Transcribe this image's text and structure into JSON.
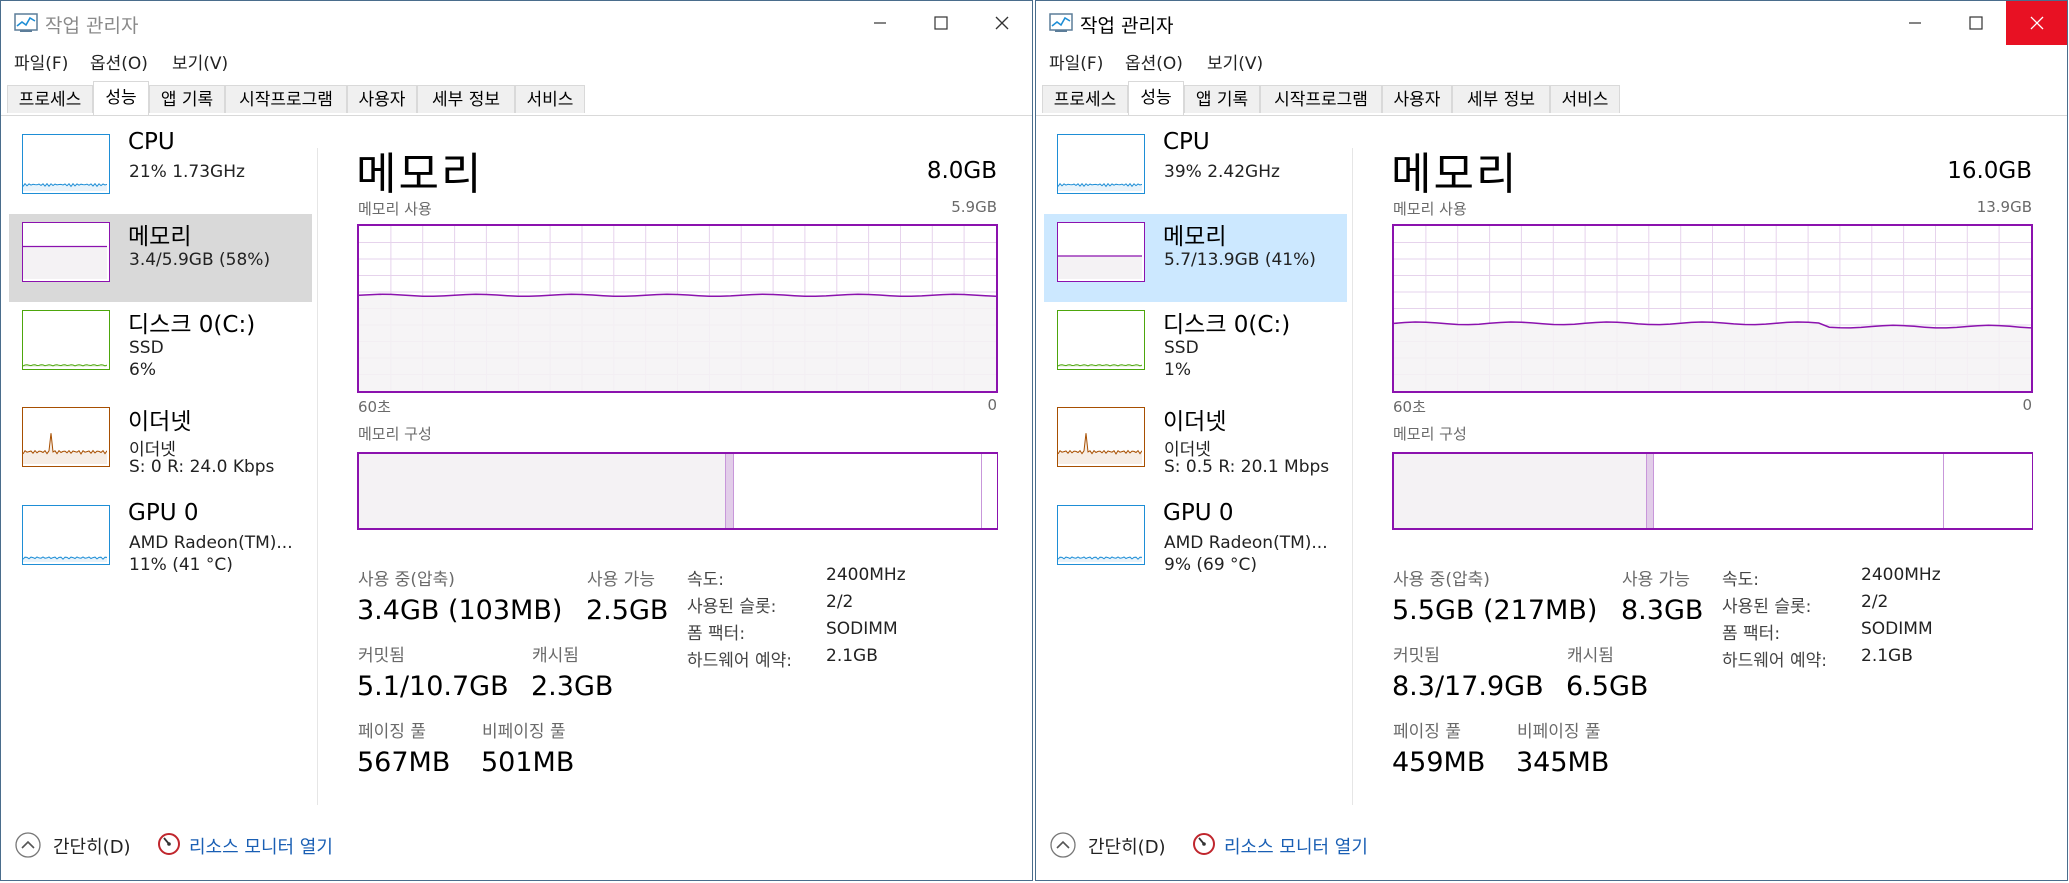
{
  "windows": [
    {
      "title": "작업 관리자",
      "active": false,
      "menu": [
        "파일(F)",
        "옵션(O)",
        "보기(V)"
      ],
      "tabs": [
        "프로세스",
        "성능",
        "앱 기록",
        "시작프로그램",
        "사용자",
        "세부 정보",
        "서비스"
      ],
      "selected_tab": 1,
      "sidebar": [
        {
          "title": "CPU",
          "lines": [
            "21% 1.73GHz"
          ],
          "color": "#1e8ed6",
          "kind": "cpu"
        },
        {
          "title": "메모리",
          "lines": [
            "3.4/5.9GB (58%)"
          ],
          "color": "#8b12ae",
          "kind": "mem",
          "level": 0.58
        },
        {
          "title": "디스크 0(C:)",
          "lines": [
            "SSD",
            "6%"
          ],
          "color": "#4da60c",
          "kind": "disk"
        },
        {
          "title": "이더넷",
          "lines": [
            "이더넷",
            "S: 0 R: 24.0 Kbps"
          ],
          "color": "#a74f01",
          "kind": "eth"
        },
        {
          "title": "GPU 0",
          "lines": [
            "AMD Radeon(TM)...",
            "11% (41 °C)"
          ],
          "color": "#1e8ed6",
          "kind": "gpu"
        }
      ],
      "memory": {
        "title": "메모리",
        "total": "8.0GB",
        "usage_label": "메모리 사용",
        "usage_max": "5.9GB",
        "axis_left": "60초",
        "axis_right": "0",
        "usage_level": 0.58,
        "composition_label": "메모리 구성",
        "composition": {
          "in_use": 0.575,
          "modified": 0.012,
          "standby": 0.39,
          "free": 0.023
        },
        "stats": [
          {
            "label": "사용 중(압축)",
            "value": "3.4GB (103MB)"
          },
          {
            "label": "사용 가능",
            "value": "2.5GB"
          },
          {
            "label": "커밋됨",
            "value": "5.1/10.7GB"
          },
          {
            "label": "캐시됨",
            "value": "2.3GB"
          },
          {
            "label": "페이징 풀",
            "value": "567MB"
          },
          {
            "label": "비페이징 풀",
            "value": "501MB"
          }
        ],
        "details": [
          {
            "label": "속도:",
            "value": "2400MHz"
          },
          {
            "label": "사용된 슬롯:",
            "value": "2/2"
          },
          {
            "label": "폼 팩터:",
            "value": "SODIMM"
          },
          {
            "label": "하드웨어 예약:",
            "value": "2.1GB"
          }
        ]
      },
      "footer": {
        "fewer": "간단히(D)",
        "resource_monitor": "리소스 모니터 열기"
      }
    },
    {
      "title": "작업 관리자",
      "active": true,
      "menu": [
        "파일(F)",
        "옵션(O)",
        "보기(V)"
      ],
      "tabs": [
        "프로세스",
        "성능",
        "앱 기록",
        "시작프로그램",
        "사용자",
        "세부 정보",
        "서비스"
      ],
      "selected_tab": 1,
      "sidebar": [
        {
          "title": "CPU",
          "lines": [
            "39% 2.42GHz"
          ],
          "color": "#1e8ed6",
          "kind": "cpu"
        },
        {
          "title": "메모리",
          "lines": [
            "5.7/13.9GB (41%)"
          ],
          "color": "#8b12ae",
          "kind": "mem",
          "level": 0.41
        },
        {
          "title": "디스크 0(C:)",
          "lines": [
            "SSD",
            "1%"
          ],
          "color": "#4da60c",
          "kind": "disk"
        },
        {
          "title": "이더넷",
          "lines": [
            "이더넷",
            "S: 0.5 R: 20.1 Mbps"
          ],
          "color": "#a74f01",
          "kind": "eth"
        },
        {
          "title": "GPU 0",
          "lines": [
            "AMD Radeon(TM)...",
            "9% (69 °C)"
          ],
          "color": "#1e8ed6",
          "kind": "gpu"
        }
      ],
      "memory": {
        "title": "메모리",
        "total": "16.0GB",
        "usage_label": "메모리 사용",
        "usage_max": "13.9GB",
        "axis_left": "60초",
        "axis_right": "0",
        "usage_level": 0.41,
        "composition_label": "메모리 구성",
        "composition": {
          "in_use": 0.395,
          "modified": 0.012,
          "standby": 0.455,
          "free": 0.138
        },
        "stats": [
          {
            "label": "사용 중(압축)",
            "value": "5.5GB (217MB)"
          },
          {
            "label": "사용 가능",
            "value": "8.3GB"
          },
          {
            "label": "커밋됨",
            "value": "8.3/17.9GB"
          },
          {
            "label": "캐시됨",
            "value": "6.5GB"
          },
          {
            "label": "페이징 풀",
            "value": "459MB"
          },
          {
            "label": "비페이징 풀",
            "value": "345MB"
          }
        ],
        "details": [
          {
            "label": "속도:",
            "value": "2400MHz"
          },
          {
            "label": "사용된 슬롯:",
            "value": "2/2"
          },
          {
            "label": "폼 팩터:",
            "value": "SODIMM"
          },
          {
            "label": "하드웨어 예약:",
            "value": "2.1GB"
          }
        ]
      },
      "footer": {
        "fewer": "간단히(D)",
        "resource_monitor": "리소스 모니터 열기"
      }
    }
  ],
  "colors": {
    "memory": "#8b12ae",
    "memory_fill": "#f4f2f4",
    "grid": "#e6d3ec",
    "cpu": "#1e8ed6",
    "disk": "#4da60c",
    "ethernet": "#a74f01",
    "sel_active": "#cce8ff",
    "sel_inactive": "#d9d9d9",
    "close_active": "#e81123"
  },
  "icons": [
    "task-manager-icon",
    "minimize-icon",
    "maximize-icon",
    "close-icon",
    "chevron-up-icon",
    "resource-monitor-icon"
  ]
}
